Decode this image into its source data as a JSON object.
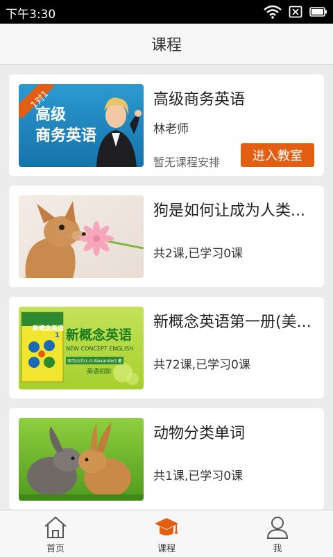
{
  "status_bar": {
    "time": "下午3:30"
  },
  "header": {
    "title": "课程"
  },
  "courses": [
    {
      "title": "高级商务英语",
      "teacher": "林老师",
      "schedule": "暂无课程安排",
      "button": "进入教室",
      "thumb": {
        "badge": "1对1",
        "line1": "高级",
        "line2": "商务英语",
        "icon": "businesswoman-thumbnail"
      }
    },
    {
      "title": "狗是如何让成为人类...",
      "progress": "共2课,已学习0课",
      "thumb": {
        "icon": "puppy-with-flower-thumbnail"
      }
    },
    {
      "title": "新概念英语第一册(美...",
      "progress": "共72课,已学习0课",
      "thumb": {
        "heading": "新概念英语",
        "english": "NEW CONCEPT ENGLISH",
        "author": "亚历山大(L.G.Alexander) 著",
        "level": "英语初阶",
        "book_title": "新概念英语",
        "book_num": "1",
        "icon": "new-concept-english-book-thumbnail"
      }
    },
    {
      "title": "动物分类单词",
      "progress": "共1课,已学习0课",
      "thumb": {
        "icon": "rabbits-thumbnail"
      }
    }
  ],
  "nav": [
    {
      "label": "首页",
      "icon": "home-icon"
    },
    {
      "label": "课程",
      "icon": "graduation-cap-icon",
      "active": true
    },
    {
      "label": "我",
      "icon": "person-icon"
    }
  ],
  "colors": {
    "accent": "#e25e13",
    "background": "#ececec",
    "card": "#ffffff",
    "status_bar": "#000000"
  }
}
